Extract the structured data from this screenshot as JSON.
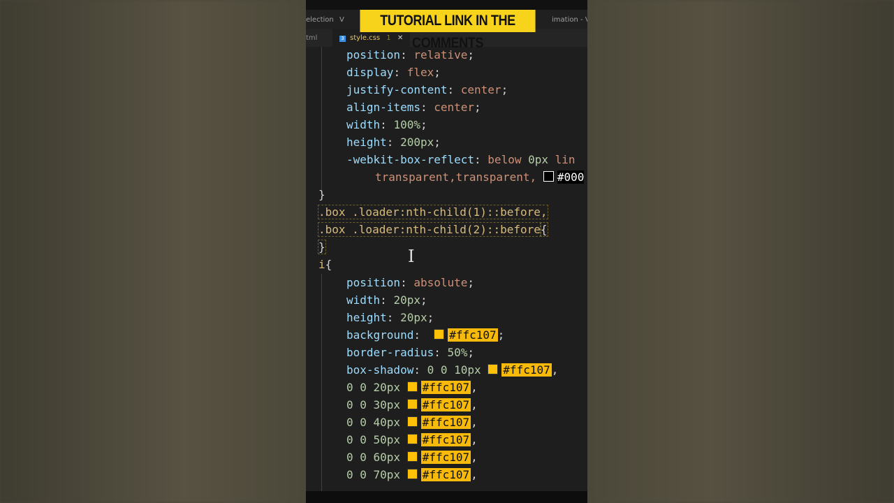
{
  "banner": {
    "text": "TUTORIAL LINK IN THE COMMENTS"
  },
  "titlebar": {
    "menu_left": "election",
    "menu_mid": "V",
    "window_title": "imation - Visu"
  },
  "tabs": {
    "left_tab": "tml",
    "active_tab": "style.css",
    "active_tab_marker": "1",
    "close_symbol": "✕",
    "css_icon_text": "3"
  },
  "code": {
    "l1_prop": "position",
    "l1_val": "relative",
    "l2_prop": "display",
    "l2_val": "flex",
    "l3_prop": "justify-content",
    "l3_val": "center",
    "l4_prop": "align-items",
    "l4_val": "center",
    "l5_prop": "width",
    "l5_val": "100%",
    "l6_prop": "height",
    "l6_val": "200px",
    "l7_prop": "-webkit-box-reflect",
    "l7_val": "below",
    "l7_num": "0px",
    "l7_tail": "lin",
    "l8_val": "transparent,transparent,",
    "l8_hex": "#000",
    "l9_brace": "}",
    "l10_sel": ".box .loader:nth-child(1)::before,",
    "l11_sel": ".box .loader:nth-child(2)::before",
    "l11_brace": "{",
    "l12_brace": "}",
    "l13_sel": "i",
    "l13_brace": "{",
    "l14_prop": "position",
    "l14_val": "absolute",
    "l15_prop": "width",
    "l15_val": "20px",
    "l16_prop": "height",
    "l16_val": "20px",
    "l17_prop": "background",
    "l17_hex": "#ffc107",
    "l18_prop": "border-radius",
    "l18_val": "50%",
    "l19_prop": "box-shadow",
    "l19_val": "0 0 10px",
    "l19_hex": "#ffc107",
    "shadow_rows": [
      {
        "offset": "0 0 20px",
        "hex": "#ffc107"
      },
      {
        "offset": "0 0 30px",
        "hex": "#ffc107"
      },
      {
        "offset": "0 0 40px",
        "hex": "#ffc107"
      },
      {
        "offset": "0 0 50px",
        "hex": "#ffc107"
      },
      {
        "offset": "0 0 60px",
        "hex": "#ffc107"
      },
      {
        "offset": "0 0 70px",
        "hex": "#ffc107"
      }
    ]
  },
  "colors": {
    "banner_bg": "#f7d31c",
    "swatch": "#ffc107",
    "editor_bg": "#1e1e1e"
  }
}
